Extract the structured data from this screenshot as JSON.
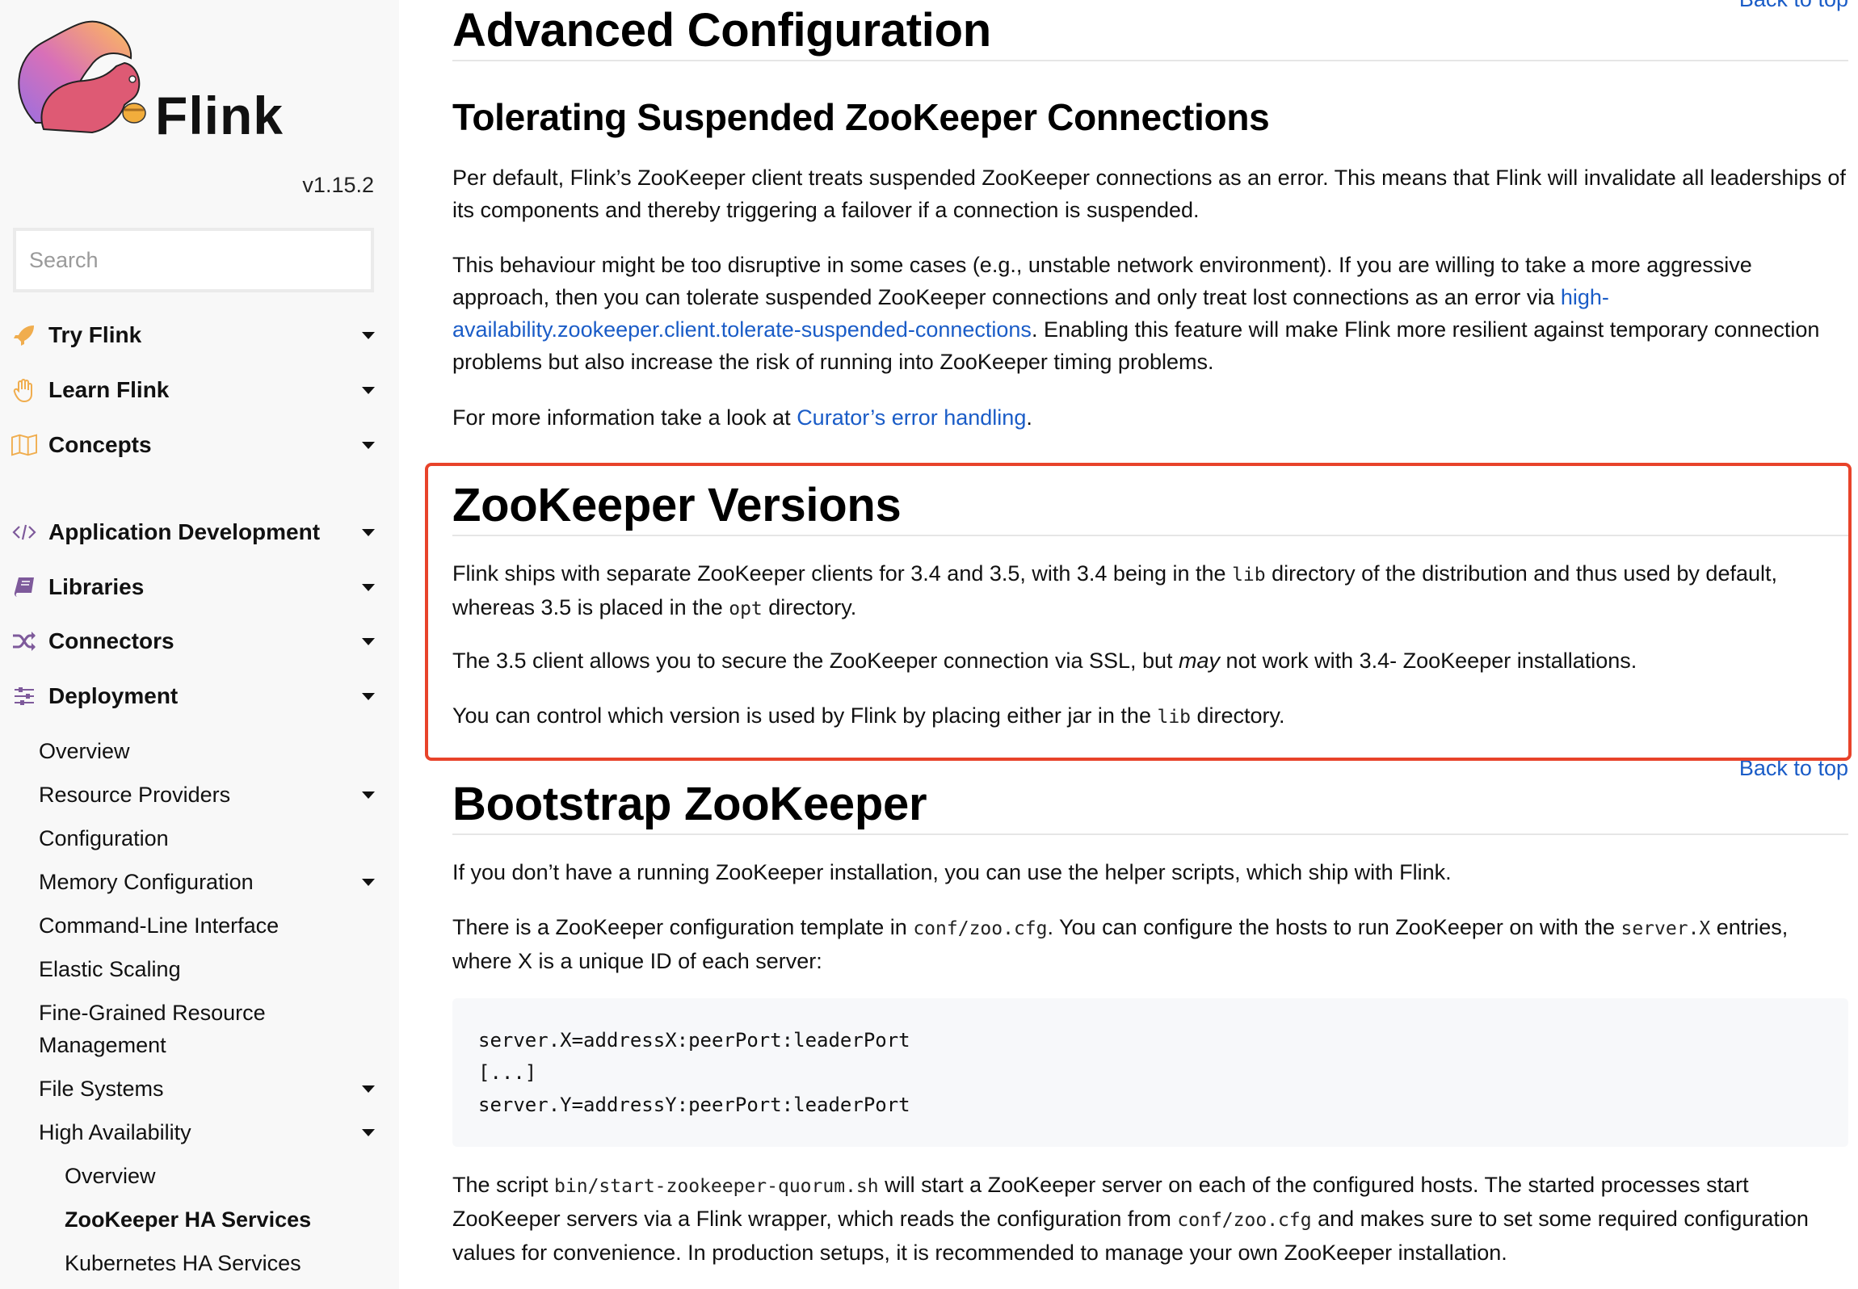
{
  "sidebar": {
    "logo_text": "Flink",
    "version": "v1.15.2",
    "search_placeholder": "Search",
    "sections": [
      {
        "label": "Try Flink",
        "icon": "rocket-icon",
        "expandable": true
      },
      {
        "label": "Learn Flink",
        "icon": "hand-icon",
        "expandable": true
      },
      {
        "label": "Concepts",
        "icon": "map-icon",
        "expandable": true
      },
      {
        "label": "Application Development",
        "icon": "code-icon",
        "expandable": true
      },
      {
        "label": "Libraries",
        "icon": "book-icon",
        "expandable": true
      },
      {
        "label": "Connectors",
        "icon": "shuffle-icon",
        "expandable": true
      },
      {
        "label": "Deployment",
        "icon": "sliders-icon",
        "expandable": true
      }
    ],
    "deployment_items": [
      {
        "label": "Overview",
        "expandable": false
      },
      {
        "label": "Resource Providers",
        "expandable": true
      },
      {
        "label": "Configuration",
        "expandable": false
      },
      {
        "label": "Memory Configuration",
        "expandable": true
      },
      {
        "label": "Command-Line Interface",
        "expandable": false
      },
      {
        "label": "Elastic Scaling",
        "expandable": false
      },
      {
        "label": "Fine-Grained Resource Management",
        "expandable": false
      },
      {
        "label": "File Systems",
        "expandable": true
      },
      {
        "label": "High Availability",
        "expandable": true
      }
    ],
    "ha_items": [
      {
        "label": "Overview",
        "active": false
      },
      {
        "label": "ZooKeeper HA Services",
        "active": true
      },
      {
        "label": "Kubernetes HA Services",
        "active": false
      }
    ],
    "colors": {
      "orange_icon": "#f0ad4e",
      "purple_icon": "#7e5a9b"
    }
  },
  "main": {
    "back_to_top": "Back to top",
    "advanced": {
      "title": "Advanced Configuration"
    },
    "tolerating": {
      "title": "Tolerating Suspended ZooKeeper Connections",
      "p1": "Per default, Flink’s ZooKeeper client treats suspended ZooKeeper connections as an error. This means that Flink will invalidate all leaderships of its components and thereby triggering a failover if a connection is suspended.",
      "p2_before": "This behaviour might be too disruptive in some cases (e.g., unstable network environment). If you are willing to take a more aggressive approach, then you can tolerate suspended ZooKeeper connections and only treat lost connections as an error via ",
      "p2_link": "high-availability.zookeeper.client.tolerate-suspended-connections",
      "p2_after": ". Enabling this feature will make Flink more resilient against temporary connection problems but also increase the risk of running into ZooKeeper timing problems.",
      "p3_before": "For more information take a look at ",
      "p3_link": "Curator’s error handling",
      "p3_after": "."
    },
    "versions": {
      "title": "ZooKeeper Versions",
      "p1_a": "Flink ships with separate ZooKeeper clients for 3.4 and 3.5, with 3.4 being in the ",
      "p1_code1": "lib",
      "p1_b": " directory of the distribution and thus used by default, whereas 3.5 is placed in the ",
      "p1_code2": "opt",
      "p1_c": " directory.",
      "p2_a": "The 3.5 client allows you to secure the ZooKeeper connection via SSL, but ",
      "p2_em": "may",
      "p2_b": " not work with 3.4- ZooKeeper installations.",
      "p3_a": "You can control which version is used by Flink by placing either jar in the ",
      "p3_code": "lib",
      "p3_b": " directory.",
      "highlight_color": "#e8432a"
    },
    "bootstrap": {
      "title": "Bootstrap ZooKeeper",
      "p1": "If you don’t have a running ZooKeeper installation, you can use the helper scripts, which ship with Flink.",
      "p2_a": "There is a ZooKeeper configuration template in ",
      "p2_code1": "conf/zoo.cfg",
      "p2_b": ". You can configure the hosts to run ZooKeeper on with the ",
      "p2_code2": "server.X",
      "p2_c": " entries, where X is a unique ID of each server:",
      "code_lines": [
        "server.X=addressX:peerPort:leaderPort",
        "[...]",
        "server.Y=addressY:peerPort:leaderPort"
      ],
      "p3_a": "The script ",
      "p3_code1": "bin/start-zookeeper-quorum.sh",
      "p3_b": " will start a ZooKeeper server on each of the configured hosts. The started processes start ZooKeeper servers via a Flink wrapper, which reads the configuration from ",
      "p3_code2": "conf/zoo.cfg",
      "p3_c": " and makes sure to set some required configuration values for convenience. In production setups, it is recommended to manage your own ZooKeeper installation."
    },
    "link_color": "#1a5cc7"
  }
}
